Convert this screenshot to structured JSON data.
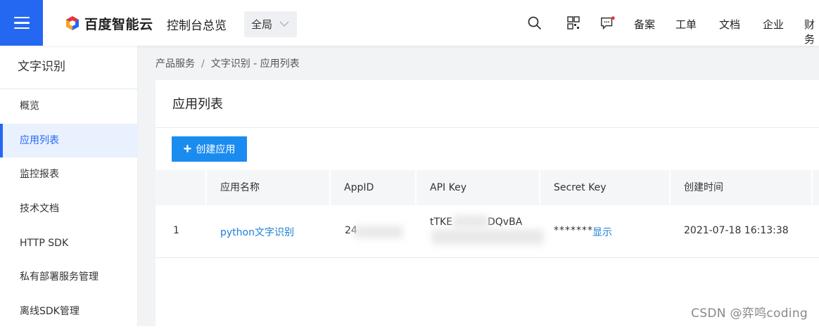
{
  "topbar": {
    "menu_icon": "hamburger-icon",
    "brand": "百度智能云",
    "console_title": "控制台总览",
    "scope": {
      "selected": "全局"
    },
    "icons": [
      "search-icon",
      "qrcode-icon",
      "message-icon"
    ],
    "links": [
      "备案",
      "工单",
      "文档",
      "企业",
      "财务"
    ],
    "brand_color": "#2468f2",
    "notify_color": "#e8343a"
  },
  "sidebar": {
    "title": "文字识别",
    "items": [
      {
        "label": "概览"
      },
      {
        "label": "应用列表",
        "active": true
      },
      {
        "label": "监控报表"
      },
      {
        "label": "技术文档"
      },
      {
        "label": "HTTP SDK"
      },
      {
        "label": "私有部署服务管理"
      },
      {
        "label": "离线SDK管理"
      }
    ]
  },
  "breadcrumb": {
    "root": "产品服务",
    "separator": "/",
    "current": "文字识别 - 应用列表"
  },
  "main": {
    "title": "应用列表",
    "create_button": {
      "icon": "+",
      "label": "创建应用"
    },
    "table": {
      "columns": [
        "",
        "应用名称",
        "AppID",
        "API Key",
        "Secret Key",
        "创建时间"
      ],
      "rows": [
        {
          "index": "1",
          "name": "python文字识别",
          "app_id": "24",
          "api_key": "tTKE",
          "api_key_tail": "DQvBA",
          "secret_key": "*******",
          "show_label": "显示",
          "created": "2021-07-18 16:13:38"
        }
      ]
    }
  },
  "watermark": "CSDN @弈鸣coding"
}
